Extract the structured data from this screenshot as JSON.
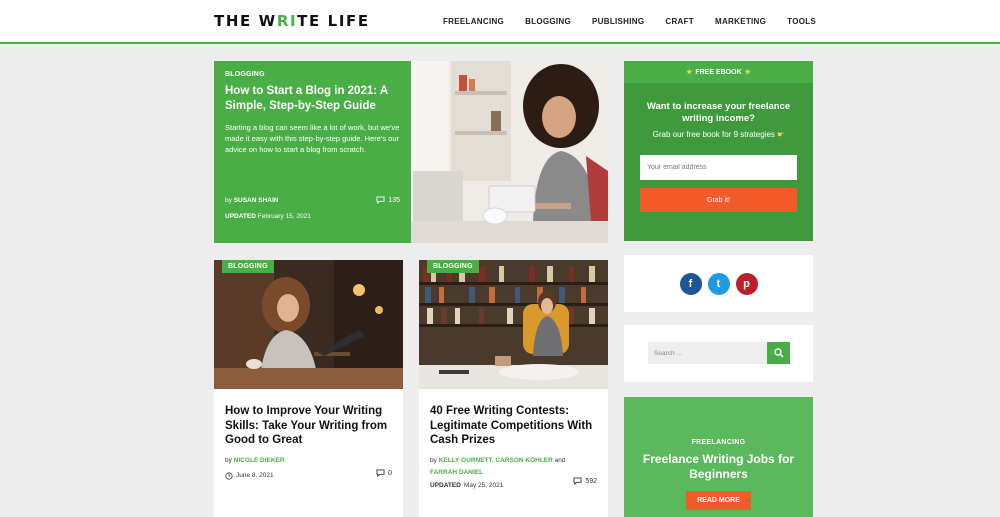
{
  "header": {
    "logo_a": "THE W",
    "logo_accent": "R",
    "logo_i": "I",
    "logo_b": "TE LIFE",
    "nav": [
      "FREELANCING",
      "BLOGGING",
      "PUBLISHING",
      "CRAFT",
      "MARKETING",
      "TOOLS"
    ]
  },
  "featured": {
    "category": "BLOGGING",
    "title": "How to Start a Blog in 2021: A Simple, Step-by-Step Guide",
    "excerpt": "Starting a blog can seem like a lot of work, but we've made it easy with this step-by-step guide. Here's our advice on how to start a blog from scratch.",
    "by_prefix": "by",
    "author": "SUSAN SHAIN",
    "comments": "135",
    "updated_label": "UPDATED",
    "updated_date": "February 15, 2021"
  },
  "cards": [
    {
      "category": "BLOGGING",
      "title": "How to Improve Your Writing Skills: Take Your Writing from Good to Great",
      "by_prefix": "by",
      "authors": "NICOLE DIEKER",
      "comments": "0",
      "date": "June 8, 2021"
    },
    {
      "category": "BLOGGING",
      "title": "40 Free Writing Contests: Legitimate Competitions With Cash Prizes",
      "by_prefix": "by",
      "author1": "KELLY GURNETT",
      "sep1": ",",
      "author2": "CARSON KOHLER",
      "and": "and",
      "author3": "FARRAH DANIEL",
      "updated_label": "UPDATED",
      "updated_date": "May 25, 2021",
      "comments": "592"
    }
  ],
  "sidebar": {
    "ebook": {
      "label": "FREE EBOOK",
      "title": "Want to increase your freelance writing income?",
      "subtitle": "Grab our free book for 9 strategies",
      "email_placeholder": "Your email address",
      "button": "Grab it!"
    },
    "social": [
      "f",
      "t",
      "p"
    ],
    "search_placeholder": "Search ...",
    "promo": {
      "category": "FREELANCING",
      "title": "Freelance Writing Jobs for Beginners",
      "button": "READ MORE"
    }
  },
  "colors": {
    "brand_green": "#4aae47",
    "cta_orange": "#f25a29",
    "facebook": "#1e5596",
    "twitter": "#1d9be0",
    "pinterest": "#bd1e28"
  }
}
